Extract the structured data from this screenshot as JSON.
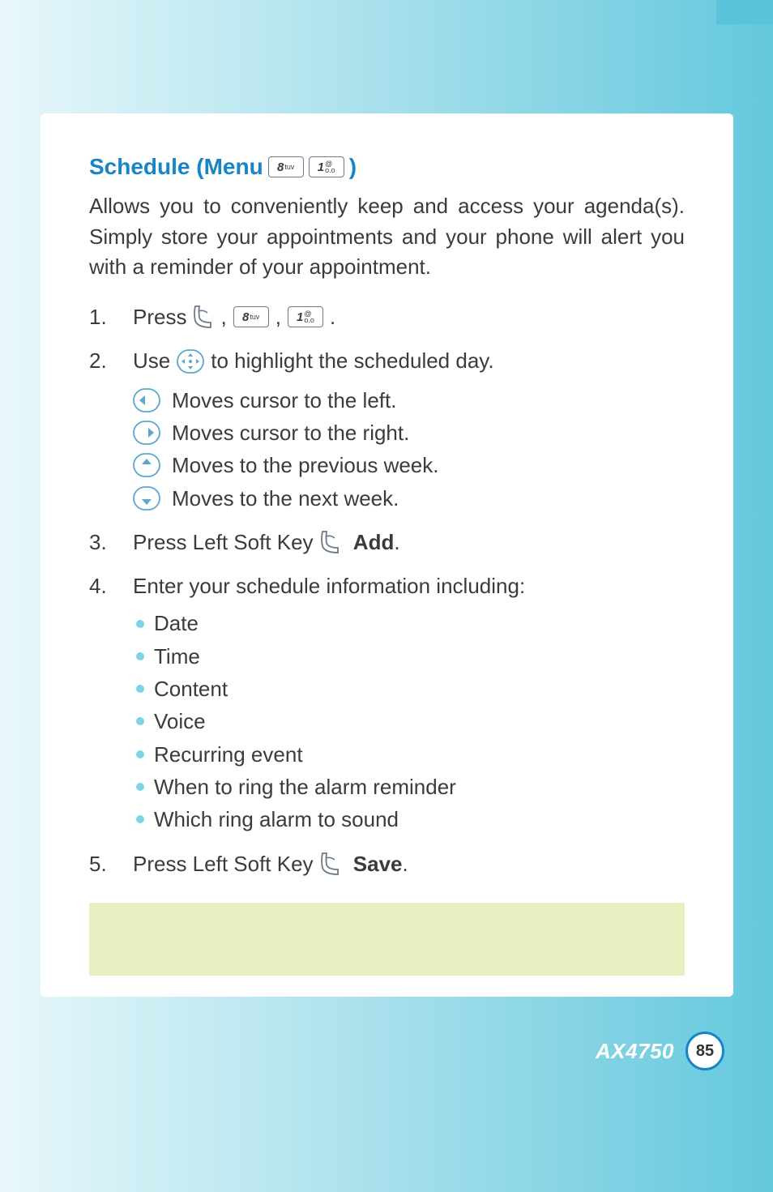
{
  "heading": {
    "title_pre": "Schedule (Menu",
    "key1_main": "8",
    "key1_sub": "tuv",
    "key2_main": "1",
    "key2_subA": "@",
    "key2_subB": "o.o",
    "title_post": ")"
  },
  "intro": "Allows you to conveniently keep and access your agenda(s). Simply store your appointments and your phone will alert you with a reminder of your appointment.",
  "steps": {
    "s1": {
      "num": "1.",
      "text_a": "Press",
      "comma": ",",
      "period": "."
    },
    "s2": {
      "num": "2.",
      "text_a": "Use",
      "text_b": "to highlight the scheduled day.",
      "rows": {
        "left": "Moves cursor to the left.",
        "right": "Moves cursor to the right.",
        "up": "Moves to the previous week.",
        "down": "Moves to the next week."
      }
    },
    "s3": {
      "num": "3.",
      "text_a": "Press Left Soft Key",
      "add": "Add",
      "period": "."
    },
    "s4": {
      "num": "4.",
      "text_a": "Enter your schedule information including:",
      "bullets": [
        "Date",
        "Time",
        "Content",
        "Voice",
        "Recurring event",
        "When to ring the alarm reminder",
        "Which ring alarm to sound"
      ]
    },
    "s5": {
      "num": "5.",
      "text_a": "Press Left Soft Key",
      "save": "Save",
      "period": "."
    }
  },
  "footer": {
    "model": "AX4750",
    "page": "85"
  }
}
